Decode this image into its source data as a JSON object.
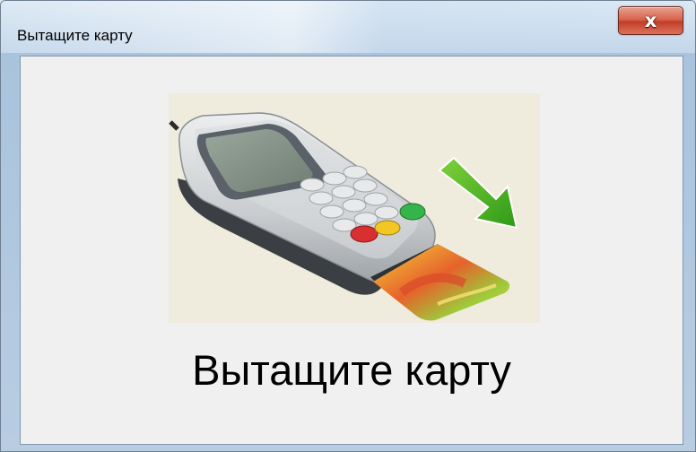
{
  "window": {
    "title": "Вытащите карту",
    "close_label": "x"
  },
  "content": {
    "message": "Вытащите карту",
    "illustration_icon": "card-terminal-remove-card-illustration"
  },
  "colors": {
    "window_frame": "#b9cfe4",
    "client_background": "#f0f0f0",
    "close_button": "#c33d28",
    "arrow": "#4caf1e",
    "illustration_background": "#efebdd"
  }
}
